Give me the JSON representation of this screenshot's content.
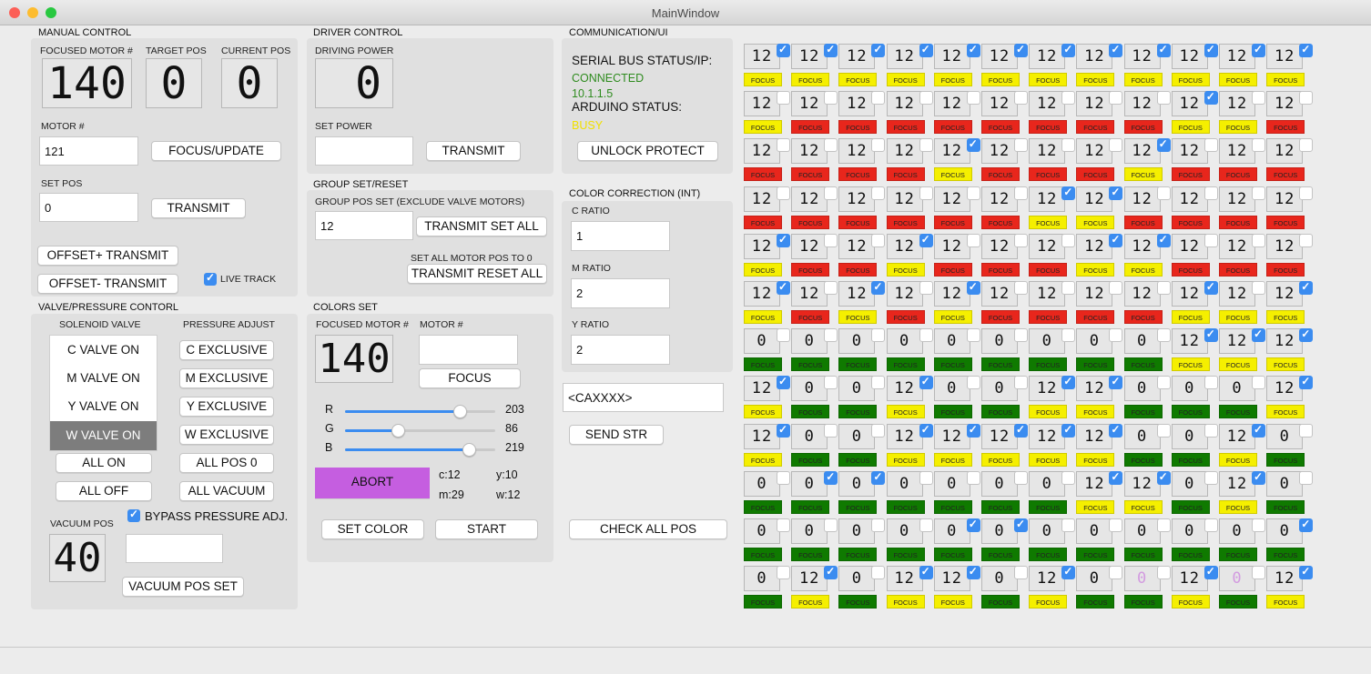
{
  "window": {
    "title": "MainWindow"
  },
  "manual": {
    "section": "MANUAL CONTROL",
    "focused_label": "FOCUSED MOTOR #",
    "target_label": "TARGET POS",
    "current_label": "CURRENT POS",
    "focused_value": "140",
    "target_value": "0",
    "current_value": "0",
    "motor_label": "MOTOR #",
    "motor_input": "121",
    "focus_update": "FOCUS/UPDATE",
    "setpos_label": "SET POS",
    "setpos_input": "0",
    "transmit": "TRANSMIT",
    "offset_plus": "OFFSET+ TRANSMIT",
    "offset_minus": "OFFSET- TRANSMIT",
    "live_track": "LIVE TRACK"
  },
  "valve": {
    "section": "VALVE/PRESSURE CONTORL",
    "solenoid_label": "SOLENOID VALVE",
    "pressure_label": "PRESSURE ADJUST",
    "valves": [
      "C VALVE ON",
      "M VALVE ON",
      "Y VALVE ON",
      "W VALVE ON"
    ],
    "exclusive": [
      "C EXCLUSIVE",
      "M EXCLUSIVE",
      "Y EXCLUSIVE",
      "W EXCLUSIVE"
    ],
    "all_on": "ALL ON",
    "all_pos0": "ALL POS 0",
    "all_off": "ALL OFF",
    "all_vacuum": "ALL VACUUM",
    "bypass": "BYPASS PRESSURE ADJ.",
    "vacuum_label": "VACUUM POS",
    "vacuum_value": "40",
    "vacuum_set": "VACUUM POS SET"
  },
  "driver": {
    "section": "DRIVER CONTROL",
    "power_label": "DRIVING POWER",
    "power_value": "0",
    "set_power_label": "SET POWER",
    "transmit": "TRANSMIT"
  },
  "group": {
    "section": "GROUP SET/RESET",
    "pos_set_label": "GROUP POS SET (EXCLUDE VALVE MOTORS)",
    "pos_input": "12",
    "transmit_set_all": "TRANSMIT SET ALL",
    "set_all_label": "SET ALL MOTOR POS TO 0",
    "transmit_reset_all": "TRANSMIT RESET ALL"
  },
  "colors": {
    "section": "COLORS SET",
    "focused_label": "FOCUSED MOTOR #",
    "motor_label": "MOTOR #",
    "focused_value": "140",
    "focus": "FOCUS",
    "r_label": "R",
    "g_label": "G",
    "b_label": "B",
    "r": 203,
    "g": 86,
    "b": 219,
    "abort": "ABORT",
    "abort_color": "#c55ee0",
    "c": "c:12",
    "y": "y:10",
    "m": "m:29",
    "w": "w:12",
    "set_color": "SET COLOR",
    "start": "START"
  },
  "comm": {
    "section": "COMMUNICATION/UI",
    "serial_label": "SERIAL BUS STATUS/IP:",
    "serial_status": "CONNECTED",
    "ip": "10.1.1.5",
    "arduino_label": "ARDUINO STATUS:",
    "arduino_status": "BUSY",
    "unlock": "UNLOCK PROTECT",
    "status_green": "#2e8b1e",
    "status_yellow": "#f0e000"
  },
  "correction": {
    "section": "COLOR CORRECTION (INT)",
    "c_label": "C RATIO",
    "c_value": "1",
    "m_label": "M RATIO",
    "m_value": "2",
    "y_label": "Y RATIO",
    "y_value": "2",
    "cmd_input": "<CAXXXX>",
    "send": "SEND STR",
    "check": "CHECK ALL POS"
  },
  "grid": {
    "focus_label": "FOCUS",
    "rows": [
      [
        [
          "12",
          1,
          "y"
        ],
        [
          "12",
          1,
          "y"
        ],
        [
          "12",
          1,
          "y"
        ],
        [
          "12",
          1,
          "y"
        ],
        [
          "12",
          1,
          "y"
        ],
        [
          "12",
          1,
          "y"
        ],
        [
          "12",
          1,
          "y"
        ],
        [
          "12",
          1,
          "y"
        ],
        [
          "12",
          1,
          "y"
        ],
        [
          "12",
          1,
          "y"
        ],
        [
          "12",
          1,
          "y"
        ],
        [
          "12",
          1,
          "y"
        ]
      ],
      [
        [
          "12",
          0,
          "y"
        ],
        [
          "12",
          0,
          "r"
        ],
        [
          "12",
          0,
          "r"
        ],
        [
          "12",
          0,
          "r"
        ],
        [
          "12",
          0,
          "r"
        ],
        [
          "12",
          0,
          "r"
        ],
        [
          "12",
          0,
          "r"
        ],
        [
          "12",
          0,
          "r"
        ],
        [
          "12",
          0,
          "r"
        ],
        [
          "12",
          1,
          "y"
        ],
        [
          "12",
          0,
          "y"
        ],
        [
          "12",
          0,
          "r"
        ]
      ],
      [
        [
          "12",
          0,
          "r"
        ],
        [
          "12",
          0,
          "r"
        ],
        [
          "12",
          0,
          "r"
        ],
        [
          "12",
          0,
          "r"
        ],
        [
          "12",
          1,
          "y"
        ],
        [
          "12",
          0,
          "r"
        ],
        [
          "12",
          0,
          "r"
        ],
        [
          "12",
          0,
          "r"
        ],
        [
          "12",
          1,
          "y"
        ],
        [
          "12",
          0,
          "r"
        ],
        [
          "12",
          0,
          "r"
        ],
        [
          "12",
          0,
          "r"
        ]
      ],
      [
        [
          "12",
          0,
          "r"
        ],
        [
          "12",
          0,
          "r"
        ],
        [
          "12",
          0,
          "r"
        ],
        [
          "12",
          0,
          "r"
        ],
        [
          "12",
          0,
          "r"
        ],
        [
          "12",
          0,
          "r"
        ],
        [
          "12",
          1,
          "y"
        ],
        [
          "12",
          1,
          "y"
        ],
        [
          "12",
          0,
          "r"
        ],
        [
          "12",
          0,
          "r"
        ],
        [
          "12",
          0,
          "r"
        ],
        [
          "12",
          0,
          "r"
        ]
      ],
      [
        [
          "12",
          1,
          "y"
        ],
        [
          "12",
          0,
          "r"
        ],
        [
          "12",
          0,
          "r"
        ],
        [
          "12",
          1,
          "y"
        ],
        [
          "12",
          0,
          "r"
        ],
        [
          "12",
          0,
          "r"
        ],
        [
          "12",
          0,
          "r"
        ],
        [
          "12",
          1,
          "y"
        ],
        [
          "12",
          1,
          "y"
        ],
        [
          "12",
          0,
          "r"
        ],
        [
          "12",
          0,
          "r"
        ],
        [
          "12",
          0,
          "r"
        ]
      ],
      [
        [
          "12",
          1,
          "y"
        ],
        [
          "12",
          0,
          "r"
        ],
        [
          "12",
          1,
          "y"
        ],
        [
          "12",
          0,
          "r"
        ],
        [
          "12",
          1,
          "y"
        ],
        [
          "12",
          0,
          "r"
        ],
        [
          "12",
          0,
          "r"
        ],
        [
          "12",
          0,
          "r"
        ],
        [
          "12",
          0,
          "r"
        ],
        [
          "12",
          1,
          "y"
        ],
        [
          "12",
          0,
          "y"
        ],
        [
          "12",
          1,
          "y"
        ]
      ],
      [
        [
          "0",
          0,
          "g"
        ],
        [
          "0",
          0,
          "g"
        ],
        [
          "0",
          0,
          "g"
        ],
        [
          "0",
          0,
          "g"
        ],
        [
          "0",
          0,
          "g"
        ],
        [
          "0",
          0,
          "g"
        ],
        [
          "0",
          0,
          "g"
        ],
        [
          "0",
          0,
          "g"
        ],
        [
          "0",
          0,
          "g"
        ],
        [
          "12",
          1,
          "y"
        ],
        [
          "12",
          1,
          "y"
        ],
        [
          "12",
          1,
          "y"
        ]
      ],
      [
        [
          "12",
          1,
          "y"
        ],
        [
          "0",
          0,
          "g"
        ],
        [
          "0",
          0,
          "g"
        ],
        [
          "12",
          1,
          "y"
        ],
        [
          "0",
          0,
          "g"
        ],
        [
          "0",
          0,
          "g"
        ],
        [
          "12",
          1,
          "y"
        ],
        [
          "12",
          1,
          "y"
        ],
        [
          "0",
          0,
          "g"
        ],
        [
          "0",
          0,
          "g"
        ],
        [
          "0",
          0,
          "g"
        ],
        [
          "12",
          1,
          "y"
        ]
      ],
      [
        [
          "12",
          1,
          "y"
        ],
        [
          "0",
          0,
          "g"
        ],
        [
          "0",
          0,
          "g"
        ],
        [
          "12",
          1,
          "y"
        ],
        [
          "12",
          1,
          "y"
        ],
        [
          "12",
          1,
          "y"
        ],
        [
          "12",
          1,
          "y"
        ],
        [
          "12",
          1,
          "y"
        ],
        [
          "0",
          0,
          "g"
        ],
        [
          "0",
          0,
          "g"
        ],
        [
          "12",
          1,
          "y"
        ],
        [
          "0",
          0,
          "g"
        ]
      ],
      [
        [
          "0",
          0,
          "g"
        ],
        [
          "0",
          1,
          "g"
        ],
        [
          "0",
          1,
          "g"
        ],
        [
          "0",
          0,
          "g"
        ],
        [
          "0",
          0,
          "g"
        ],
        [
          "0",
          0,
          "g"
        ],
        [
          "0",
          0,
          "g"
        ],
        [
          "12",
          1,
          "y"
        ],
        [
          "12",
          1,
          "y"
        ],
        [
          "0",
          0,
          "g"
        ],
        [
          "12",
          1,
          "y"
        ],
        [
          "0",
          0,
          "g"
        ]
      ],
      [
        [
          "0",
          0,
          "g"
        ],
        [
          "0",
          0,
          "g"
        ],
        [
          "0",
          0,
          "g"
        ],
        [
          "0",
          0,
          "g"
        ],
        [
          "0",
          1,
          "g"
        ],
        [
          "0",
          1,
          "g"
        ],
        [
          "0",
          0,
          "g"
        ],
        [
          "0",
          0,
          "g"
        ],
        [
          "0",
          0,
          "g"
        ],
        [
          "0",
          0,
          "g"
        ],
        [
          "0",
          0,
          "g"
        ],
        [
          "0",
          1,
          "g"
        ]
      ],
      [
        [
          "0",
          0,
          "g"
        ],
        [
          "12",
          1,
          "y"
        ],
        [
          "0",
          0,
          "g"
        ],
        [
          "12",
          1,
          "y"
        ],
        [
          "12",
          1,
          "y"
        ],
        [
          "0",
          0,
          "g"
        ],
        [
          "12",
          1,
          "y"
        ],
        [
          "0",
          0,
          "g"
        ],
        [
          "0p",
          0,
          "g"
        ],
        [
          "12",
          1,
          "y"
        ],
        [
          "0p",
          0,
          "g"
        ],
        [
          "12",
          1,
          "y"
        ]
      ]
    ]
  }
}
